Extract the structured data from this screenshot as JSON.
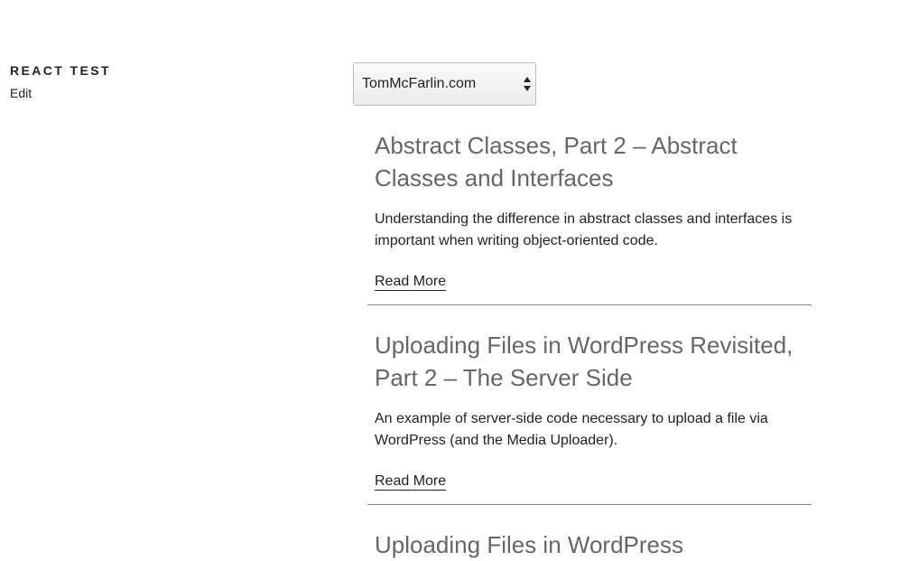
{
  "header": {
    "title": "React Test",
    "edit_label": "Edit"
  },
  "site_select": {
    "selected": "TomMcFarlin.com"
  },
  "posts": [
    {
      "title": "Abstract Classes, Part 2 – Abstract Classes and Interfaces",
      "excerpt": "Understanding the difference in abstract classes and interfaces is important when writing object-oriented code.",
      "read_more": "Read More"
    },
    {
      "title": "Uploading Files in WordPress Revisited, Part 2 – The Server Side",
      "excerpt": "An example of server-side code necessary to upload a file via WordPress (and the Media Uploader).",
      "read_more": "Read More"
    },
    {
      "title": "Uploading Files in WordPress",
      "excerpt": "",
      "read_more": ""
    }
  ]
}
